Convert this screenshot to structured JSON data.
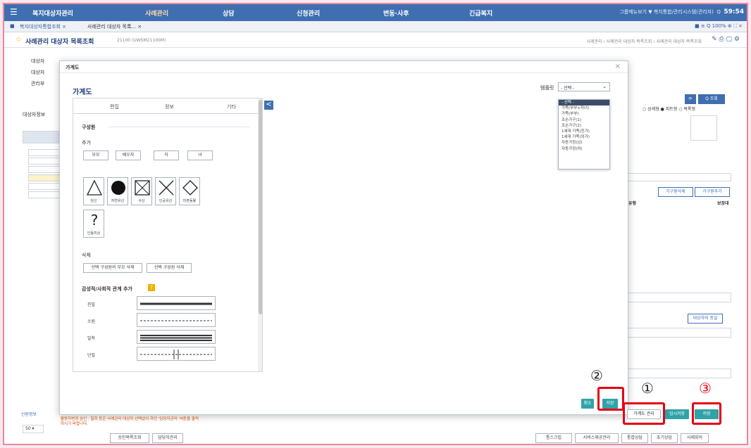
{
  "topnav": {
    "menus": [
      "복지대상자관리",
      "사례관리",
      "상담",
      "신청관리",
      "변동·사후",
      "긴급복지"
    ],
    "util_text": "그룹메뉴보기 ▼  복지통합/관리시스템(관리자)",
    "time": "59:54"
  },
  "tabs": [
    "복지대상자통합조회 ×",
    "사례관리 대상자 목록... ×"
  ],
  "tab_tools": "■ ≡ Q 100% ⊕ ⛶ ×",
  "page": {
    "title": "사례관리 대상자 목록조회",
    "code": "21100 (UWSM21100M)",
    "breadcrumb": "사례관리 › 사례관리 대상자 목록조회 › 사례관리 대상자 목록조회",
    "icons": "✎ ⎙ ▢ ⚙"
  },
  "background": {
    "labels": [
      "대상자",
      "대상자",
      "관리부",
      "대상자정보"
    ],
    "radio_labels": [
      "상세형",
      "피트형",
      "목록형"
    ],
    "search_button": "Q 조회",
    "right_buttons": [
      "가구원삭제",
      "가구원추가"
    ],
    "right_headers": [
      "유형",
      "보장대"
    ],
    "right_btn2": "대상자와 동일",
    "pager": "50",
    "side_label": "신원정보"
  },
  "modal": {
    "window_title": "가계도",
    "title": "가계도",
    "close": "×",
    "template_label": "템플릿",
    "template_selected": "- 선택 -",
    "template_options": [
      "- 선택 -",
      "가족(부부+자녀)",
      "가족(부부)",
      "조손가구(1)",
      "조손가구(2)",
      "1세대 가족(친가)",
      "1세대 가족(외가)",
      "자동가정(남)",
      "자동가정(여)"
    ],
    "panel_tabs": [
      "편집",
      "정보",
      "기타"
    ],
    "collapse": "<",
    "sections": {
      "members": "구성원",
      "add": "추가",
      "delete": "삭제",
      "relations": "감성적/사회적 관계 추가"
    },
    "add_buttons": [
      "부모",
      "배우자",
      "자",
      "녀"
    ],
    "shapes": [
      "임신",
      "자연유산",
      "사산",
      "인공유산",
      "미혼동물",
      "인동미상"
    ],
    "delete_buttons": [
      "선택 구성원의 부모 삭제",
      "선택 구성원 삭제"
    ],
    "relations": [
      "친밀",
      "소원",
      "밀착",
      "단절"
    ]
  },
  "actions": {
    "modal_cancel": "취소",
    "modal_save": "저장",
    "genogram_manage": "가계도 관리",
    "temp_save": "임시저장",
    "save": "저장"
  },
  "markers": [
    "②",
    "①",
    "③"
  ],
  "bottom_buttons": [
    "승인목록조회",
    "담당자관리",
    "통스크립",
    "서비스제공관리",
    "통합상담",
    "초기상담",
    "사례회의"
  ],
  "notice": "활동자변경 승인 · 철회 등은 사례관리 대상자 선택없이 하단 '담당자관리' 버튼을 클릭하시기 바랍니다."
}
